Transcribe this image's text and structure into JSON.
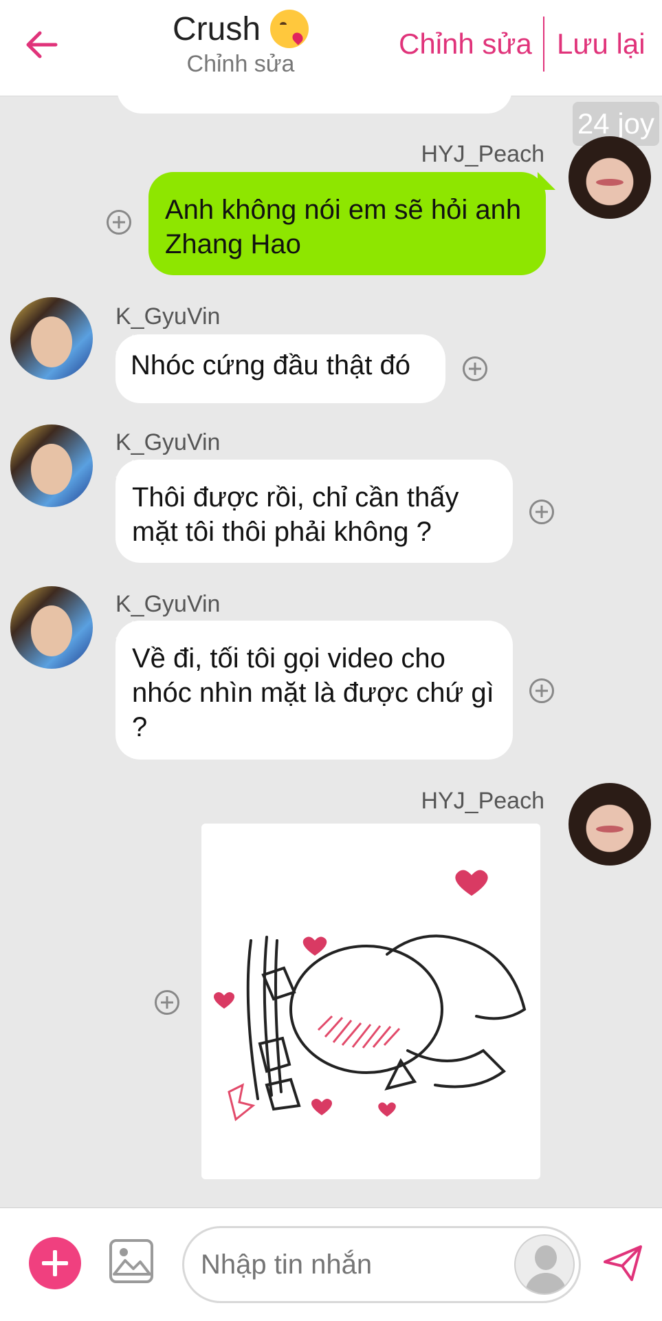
{
  "header": {
    "title": "Crush",
    "title_emoji": "face-blowing-kiss-emoji",
    "subtitle": "Chỉnh sửa",
    "edit_label": "Chỉnh sửa",
    "save_label": "Lưu lại"
  },
  "watermark": "24 joy",
  "messages": [
    {
      "sender": "HYJ_Peach",
      "side": "right",
      "text": "Anh không nói em sẽ hỏi anh Zhang Hao"
    },
    {
      "sender": "K_GyuVin",
      "side": "left",
      "text": "Nhóc cứng đầu thật đó"
    },
    {
      "sender": "K_GyuVin",
      "side": "left",
      "text": "Thôi được rồi, chỉ cần thấy mặt tôi thôi phải không ?"
    },
    {
      "sender": "K_GyuVin",
      "side": "left",
      "text": "Về đi, tối tôi gọi video cho nhóc nhìn mặt là được chứ gì ?"
    },
    {
      "sender": "HYJ_Peach",
      "side": "right",
      "type": "sticker",
      "sticker": "bowing-blushing-cartoon-sticker"
    }
  ],
  "composer": {
    "placeholder": "Nhập tin nhắn"
  },
  "colors": {
    "accent": "#e0337a",
    "my_bubble": "#8ee600",
    "their_bubble": "#ffffff",
    "chat_bg": "#e8e8e8"
  }
}
